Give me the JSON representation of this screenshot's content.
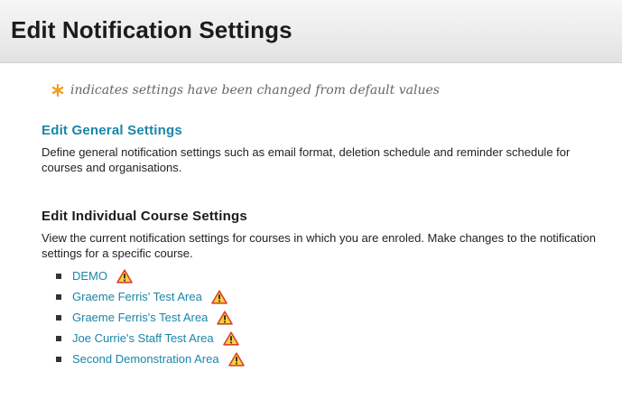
{
  "header": {
    "title": "Edit Notification Settings"
  },
  "legend": {
    "icon": "asterisk-icon",
    "icon_color": "#f39c1f",
    "text": "indicates settings have been changed from default values"
  },
  "general_settings": {
    "link_label": "Edit General Settings",
    "description": "Define general notification settings such as email format, deletion schedule and reminder schedule for courses and organisations."
  },
  "course_settings": {
    "title": "Edit Individual Course Settings",
    "description": "View the current notification settings for courses in which you are enroled. Make changes to the notification settings for a specific course.",
    "courses": [
      {
        "label": "DEMO",
        "status_icon": "warning-icon"
      },
      {
        "label": "Graeme Ferris' Test Area",
        "status_icon": "warning-icon"
      },
      {
        "label": "Graeme Ferris's Test Area",
        "status_icon": "warning-icon"
      },
      {
        "label": "Joe Currie's Staff Test Area",
        "status_icon": "warning-icon"
      },
      {
        "label": "Second Demonstration Area",
        "status_icon": "warning-icon"
      }
    ]
  },
  "colors": {
    "link": "#1a86a8",
    "warning_fill": "#ffd23a",
    "warning_border": "#d9452b"
  }
}
